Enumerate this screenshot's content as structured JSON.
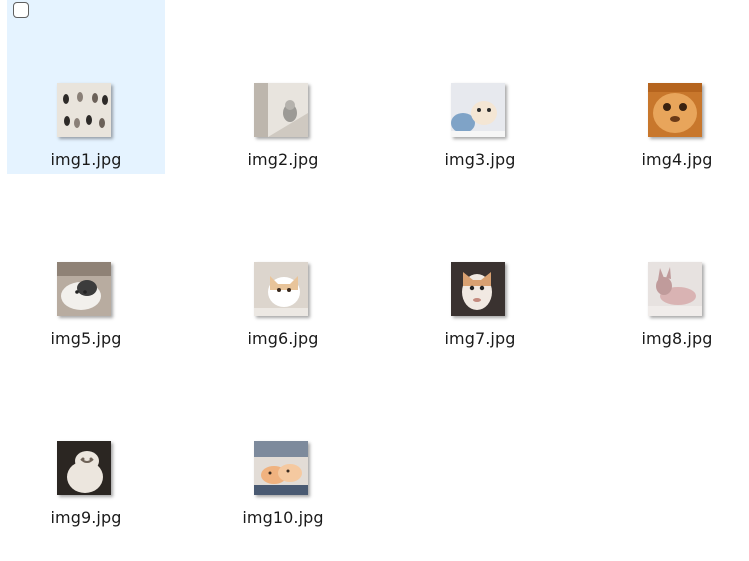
{
  "files": [
    {
      "name": "img1.jpg",
      "selected": true,
      "icon": "image-thumbnail-icon",
      "thumb_colors": [
        "#e9e4dc",
        "#2d2a28",
        "#8a8078"
      ]
    },
    {
      "name": "img2.jpg",
      "selected": false,
      "icon": "image-thumbnail-icon",
      "thumb_colors": [
        "#cfc9c1",
        "#9c9a96",
        "#e8e4de"
      ]
    },
    {
      "name": "img3.jpg",
      "selected": false,
      "icon": "image-thumbnail-icon",
      "thumb_colors": [
        "#e7e9ee",
        "#7fa3c7",
        "#f4e6d4"
      ]
    },
    {
      "name": "img4.jpg",
      "selected": false,
      "icon": "image-thumbnail-icon",
      "thumb_colors": [
        "#c8772c",
        "#e8a55b",
        "#6b3a17"
      ]
    },
    {
      "name": "img5.jpg",
      "selected": false,
      "icon": "image-thumbnail-icon",
      "thumb_colors": [
        "#b8aca0",
        "#f2f0ec",
        "#3c3c3c"
      ]
    },
    {
      "name": "img6.jpg",
      "selected": false,
      "icon": "image-thumbnail-icon",
      "thumb_colors": [
        "#dcd5cd",
        "#e8c49a",
        "#ffffff"
      ]
    },
    {
      "name": "img7.jpg",
      "selected": false,
      "icon": "image-thumbnail-icon",
      "thumb_colors": [
        "#3a3230",
        "#d8a071",
        "#f1e9e2"
      ]
    },
    {
      "name": "img8.jpg",
      "selected": false,
      "icon": "image-thumbnail-icon",
      "thumb_colors": [
        "#e7e2e0",
        "#d9b3b3",
        "#c09b9b"
      ]
    },
    {
      "name": "img9.jpg",
      "selected": false,
      "icon": "image-thumbnail-icon",
      "thumb_colors": [
        "#2b2622",
        "#ece6de",
        "#6e6257"
      ]
    },
    {
      "name": "img10.jpg",
      "selected": false,
      "icon": "image-thumbnail-icon",
      "thumb_colors": [
        "#e2dcd6",
        "#f0b27f",
        "#4a5a72"
      ]
    }
  ],
  "selection_color": "#e5f3ff"
}
